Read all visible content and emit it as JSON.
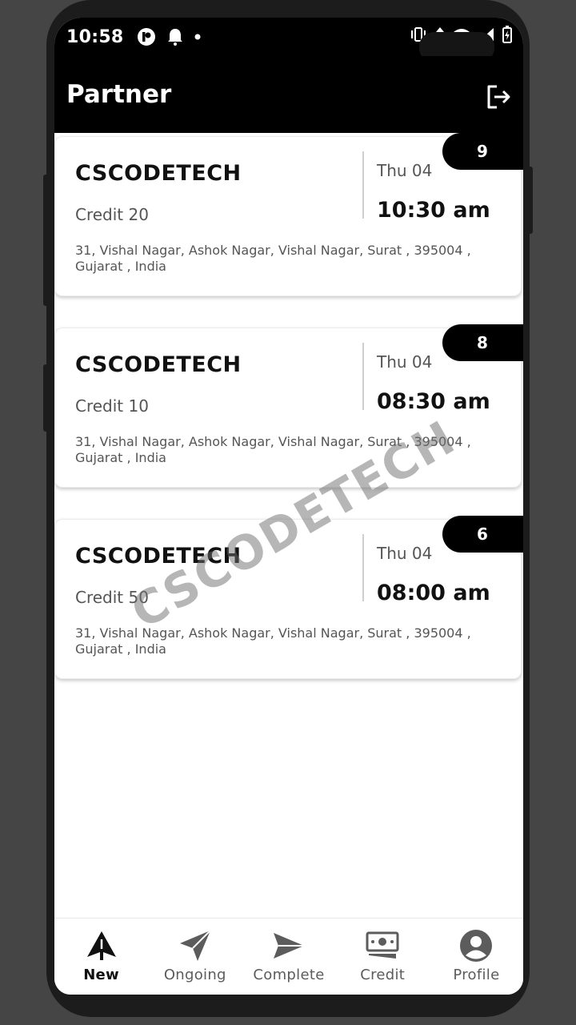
{
  "status_bar": {
    "time": "10:58"
  },
  "app_bar": {
    "title": "Partner",
    "logout_icon": "logout-icon"
  },
  "bookings": [
    {
      "badge": "9",
      "company": "CSCODETECH",
      "credit": "Credit 20",
      "day": "Thu 04",
      "time": "10:30 am",
      "address": "31, Vishal Nagar, Ashok Nagar, Vishal Nagar,  Surat , 395004 , Gujarat , India"
    },
    {
      "badge": "8",
      "company": "CSCODETECH",
      "credit": "Credit 10",
      "day": "Thu 04",
      "time": "08:30 am",
      "address": "31, Vishal Nagar, Ashok Nagar, Vishal Nagar,  Surat , 395004 , Gujarat , India"
    },
    {
      "badge": "6",
      "company": "CSCODETECH",
      "credit": "Credit 50",
      "day": "Thu 04",
      "time": "08:00 am",
      "address": "31, Vishal Nagar, Ashok Nagar, Vishal Nagar,  Surat , 395004 , Gujarat , India"
    }
  ],
  "watermark": "CSCODETECH",
  "bottom_nav": [
    {
      "label": "New",
      "icon": "alert-triangle-icon",
      "active": true
    },
    {
      "label": "Ongoing",
      "icon": "send-tilted-icon",
      "active": false
    },
    {
      "label": "Complete",
      "icon": "send-icon",
      "active": false
    },
    {
      "label": "Credit",
      "icon": "money-icon",
      "active": false
    },
    {
      "label": "Profile",
      "icon": "account-circle-icon",
      "active": false
    }
  ]
}
